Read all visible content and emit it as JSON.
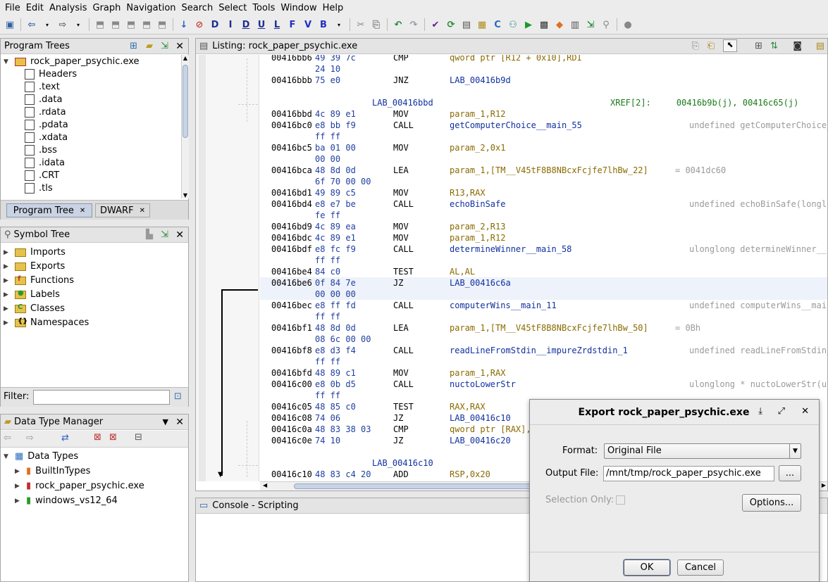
{
  "menu": [
    "File",
    "Edit",
    "Analysis",
    "Graph",
    "Navigation",
    "Search",
    "Select",
    "Tools",
    "Window",
    "Help"
  ],
  "program_trees": {
    "title": "Program Trees",
    "root": "rock_paper_psychic.exe",
    "items": [
      "Headers",
      ".text",
      ".data",
      ".rdata",
      ".pdata",
      ".xdata",
      ".bss",
      ".idata",
      ".CRT",
      ".tls"
    ],
    "tabs": [
      "Program Tree",
      "DWARF"
    ]
  },
  "symbol_tree": {
    "title": "Symbol Tree",
    "items": [
      "Imports",
      "Exports",
      "Functions",
      "Labels",
      "Classes",
      "Namespaces"
    ],
    "filter_label": "Filter:"
  },
  "data_type_manager": {
    "title": "Data Type Manager",
    "root": "Data Types",
    "items": [
      "BuiltInTypes",
      "rock_paper_psychic.exe",
      "windows_vs12_64"
    ]
  },
  "listing": {
    "title": "Listing:  rock_paper_psychic.exe",
    "rows": [
      {
        "addr": "00416bb6",
        "bytes": "49 39 7c",
        "mn": "CMP",
        "op": "qword ptr [R12 + 0x10],RDI",
        "cm": ""
      },
      {
        "addr": "",
        "bytes": "24 10",
        "mn": "",
        "op": "",
        "cm": ""
      },
      {
        "addr": "00416bbb",
        "bytes": "75 e0",
        "mn": "JNZ",
        "op": "LAB_00416b9d",
        "cm": ""
      },
      {
        "addr": "",
        "bytes": "",
        "mn": "",
        "op": "",
        "cm": ""
      },
      {
        "label": "LAB_00416bbd",
        "xref": "XREF[2]:     00416b9b(j), 00416c65(j)"
      },
      {
        "addr": "00416bbd",
        "bytes": "4c 89 e1",
        "mn": "MOV",
        "op": "param_1,R12",
        "cm": ""
      },
      {
        "addr": "00416bc0",
        "bytes": "e8 bb f9",
        "mn": "CALL",
        "op": "getComputerChoice__main_55",
        "cm": "undefined getComputerChoice_"
      },
      {
        "addr": "",
        "bytes": "ff ff",
        "mn": "",
        "op": "",
        "cm": ""
      },
      {
        "addr": "00416bc5",
        "bytes": "ba 01 00",
        "mn": "MOV",
        "op": "param_2,0x1",
        "cm": ""
      },
      {
        "addr": "",
        "bytes": "00 00",
        "mn": "",
        "op": "",
        "cm": ""
      },
      {
        "addr": "00416bca",
        "bytes": "48 8d 0d",
        "mn": "LEA",
        "op": "param_1,[TM__V45tF8B8NBcxFcjfe7lhBw_22]",
        "cm": "= 0041dc60"
      },
      {
        "addr": "",
        "bytes": "6f 70 00 00",
        "mn": "",
        "op": "",
        "cm": ""
      },
      {
        "addr": "00416bd1",
        "bytes": "49 89 c5",
        "mn": "MOV",
        "op": "R13,RAX",
        "cm": ""
      },
      {
        "addr": "00416bd4",
        "bytes": "e8 e7 be",
        "mn": "CALL",
        "op": "echoBinSafe",
        "cm": "undefined echoBinSafe(longlo"
      },
      {
        "addr": "",
        "bytes": "fe ff",
        "mn": "",
        "op": "",
        "cm": ""
      },
      {
        "addr": "00416bd9",
        "bytes": "4c 89 ea",
        "mn": "MOV",
        "op": "param_2,R13",
        "cm": ""
      },
      {
        "addr": "00416bdc",
        "bytes": "4c 89 e1",
        "mn": "MOV",
        "op": "param_1,R12",
        "cm": ""
      },
      {
        "addr": "00416bdf",
        "bytes": "e8 fc f9",
        "mn": "CALL",
        "op": "determineWinner__main_58",
        "cm": "ulonglong determineWinner__"
      },
      {
        "addr": "",
        "bytes": "ff ff",
        "mn": "",
        "op": "",
        "cm": ""
      },
      {
        "addr": "00416be4",
        "bytes": "84 c0",
        "mn": "TEST",
        "op": "AL,AL",
        "cm": ""
      },
      {
        "addr": "00416be6",
        "bytes": "0f 84 7e",
        "mn": "JZ",
        "op": "LAB_00416c6a",
        "cm": ""
      },
      {
        "addr": "",
        "bytes": "00 00 00",
        "mn": "",
        "op": "",
        "cm": ""
      },
      {
        "addr": "00416bec",
        "bytes": "e8 ff fd",
        "mn": "CALL",
        "op": "computerWins__main_11",
        "cm": "undefined computerWins__main"
      },
      {
        "addr": "",
        "bytes": "ff ff",
        "mn": "",
        "op": "",
        "cm": ""
      },
      {
        "addr": "00416bf1",
        "bytes": "48 8d 0d",
        "mn": "LEA",
        "op": "param_1,[TM__V45tF8B8NBcxFcjfe7lhBw_50]",
        "cm": "= 0Bh"
      },
      {
        "addr": "",
        "bytes": "08 6c 00 00",
        "mn": "",
        "op": "",
        "cm": ""
      },
      {
        "addr": "00416bf8",
        "bytes": "e8 d3 f4",
        "mn": "CALL",
        "op": "readLineFromStdin__impureZrdstdin_1",
        "cm": "undefined readLineFromStdin_"
      },
      {
        "addr": "",
        "bytes": "ff ff",
        "mn": "",
        "op": "",
        "cm": ""
      },
      {
        "addr": "00416bfd",
        "bytes": "48 89 c1",
        "mn": "MOV",
        "op": "param_1,RAX",
        "cm": ""
      },
      {
        "addr": "00416c00",
        "bytes": "e8 0b d5",
        "mn": "CALL",
        "op": "nuctoLowerStr",
        "cm": "ulonglong * nuctoLowerStr(ul"
      },
      {
        "addr": "",
        "bytes": "ff ff",
        "mn": "",
        "op": "",
        "cm": ""
      },
      {
        "addr": "00416c05",
        "bytes": "48 85 c0",
        "mn": "TEST",
        "op": "RAX,RAX",
        "cm": ""
      },
      {
        "addr": "00416c08",
        "bytes": "74 06",
        "mn": "JZ",
        "op": "LAB_00416c10",
        "cm": ""
      },
      {
        "addr": "00416c0a",
        "bytes": "48 83 38 03",
        "mn": "CMP",
        "op": "qword ptr [RAX],",
        "cm": ""
      },
      {
        "addr": "00416c0e",
        "bytes": "74 10",
        "mn": "JZ",
        "op": "LAB_00416c20",
        "cm": ""
      },
      {
        "addr": "",
        "bytes": "",
        "mn": "",
        "op": "",
        "cm": ""
      },
      {
        "label": "LAB_00416c10",
        "xref": ""
      },
      {
        "addr": "00416c10",
        "bytes": "48 83 c4 20",
        "mn": "ADD",
        "op": "RSP,0x20",
        "cm": ""
      }
    ]
  },
  "console": {
    "title": "Console - Scripting"
  },
  "dialog": {
    "title": "Export rock_paper_psychic.exe",
    "format_label": "Format:",
    "format_value": "Original File",
    "output_label": "Output File:",
    "output_value": "/mnt/tmp/rock_paper_psychic.exe",
    "browse_label": "...",
    "selection_label": "Selection Only:",
    "options_label": "Options...",
    "ok_label": "OK",
    "cancel_label": "Cancel"
  }
}
